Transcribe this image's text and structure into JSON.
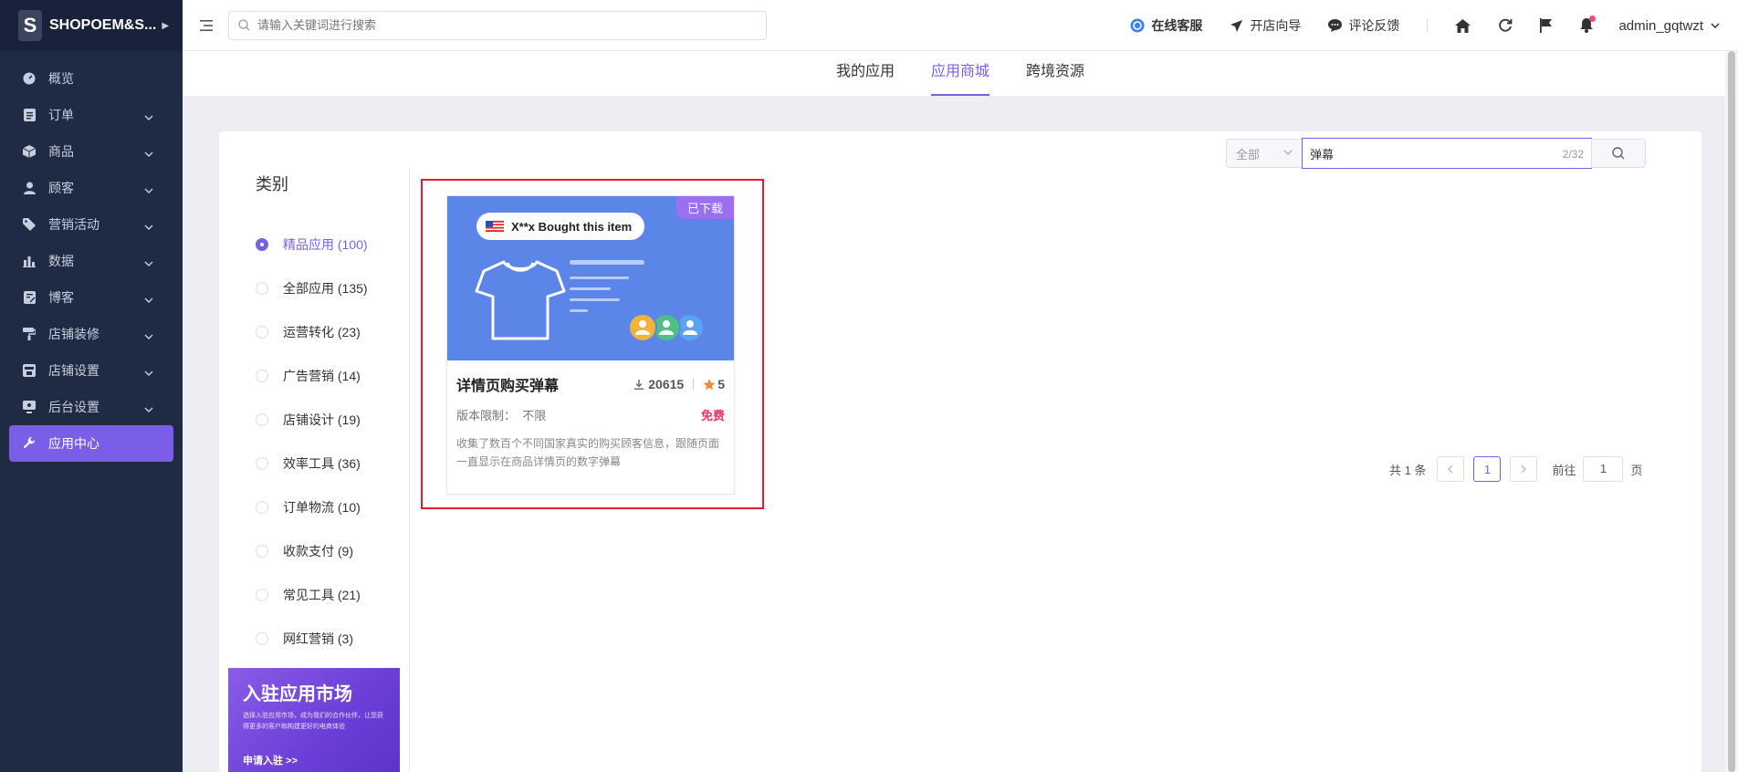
{
  "sidebar": {
    "brand_logo": "S",
    "brand_name": "SHOPOEM&S...",
    "items": [
      {
        "label": "概览",
        "icon": "dashboard-icon"
      },
      {
        "label": "订单",
        "icon": "order-icon"
      },
      {
        "label": "商品",
        "icon": "product-icon"
      },
      {
        "label": "顾客",
        "icon": "customer-icon"
      },
      {
        "label": "营销活动",
        "icon": "tag-icon"
      },
      {
        "label": "数据",
        "icon": "bar-chart-icon"
      },
      {
        "label": "博客",
        "icon": "blog-icon"
      },
      {
        "label": "店铺装修",
        "icon": "paint-roller-icon"
      },
      {
        "label": "店铺设置",
        "icon": "store-icon"
      },
      {
        "label": "后台设置",
        "icon": "monitor-icon"
      },
      {
        "label": "应用中心",
        "icon": "wrench-icon"
      }
    ]
  },
  "header": {
    "search_placeholder": "请输入关键词进行搜索",
    "links": [
      {
        "label": "在线客服",
        "icon": "headset-icon"
      },
      {
        "label": "开店向导",
        "icon": "send-icon"
      },
      {
        "label": "评论反馈",
        "icon": "comment-icon"
      }
    ],
    "user": "admin_gqtwzt"
  },
  "tabs": [
    "我的应用",
    "应用商城",
    "跨境资源"
  ],
  "categories": {
    "title": "类别",
    "items": [
      "精品应用 (100)",
      "全部应用 (135)",
      "运营转化 (23)",
      "广告营销 (14)",
      "店铺设计 (19)",
      "效率工具 (36)",
      "订单物流 (10)",
      "收款支付 (9)",
      "常见工具 (21)",
      "网红营销 (3)"
    ]
  },
  "promo": {
    "title": "入驻应用市场",
    "desc": "选择入驻应用市场，成为我们的合作伙伴，让您获得更多的客户和构建更好的电商体验",
    "cta": "申请入驻 >>"
  },
  "filter": {
    "select_value": "全部",
    "query": "弹幕",
    "count": "2/32"
  },
  "app": {
    "badge": "已下载",
    "banner_text": "X**x Bought this item",
    "name": "详情页购买弹幕",
    "downloads": "20615",
    "rating": "5",
    "version_label": "版本限制：",
    "version_value": "不限",
    "price": "免费",
    "desc": "收集了数百个不同国家真实的购买顾客信息，跟随页面一直显示在商品详情页的数字弹幕"
  },
  "pagination": {
    "total": "共 1 条",
    "current": "1",
    "goto_label": "前往",
    "goto_value": "1",
    "page_label": "页"
  },
  "colors": {
    "accent": "#7b5ee8",
    "sidebar_bg": "#1f2b45",
    "highlight": "#e11d2e",
    "price": "#e8336a"
  }
}
